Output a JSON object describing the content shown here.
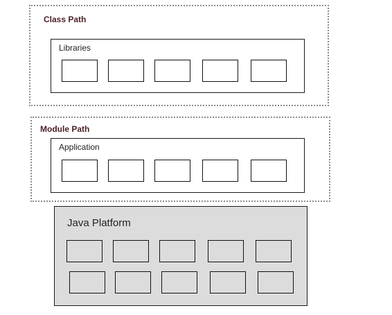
{
  "class_path": {
    "title": "Class Path",
    "inner_label": "Libraries",
    "module_count": 5
  },
  "module_path": {
    "title": "Module Path",
    "inner_label": "Application",
    "module_count": 5
  },
  "platform": {
    "title": "Java Platform",
    "rows": [
      5,
      5
    ]
  },
  "colors": {
    "title_text": "#4a1f24",
    "dotted_border": "#8a8a8a",
    "platform_fill": "#dcdcdc"
  }
}
